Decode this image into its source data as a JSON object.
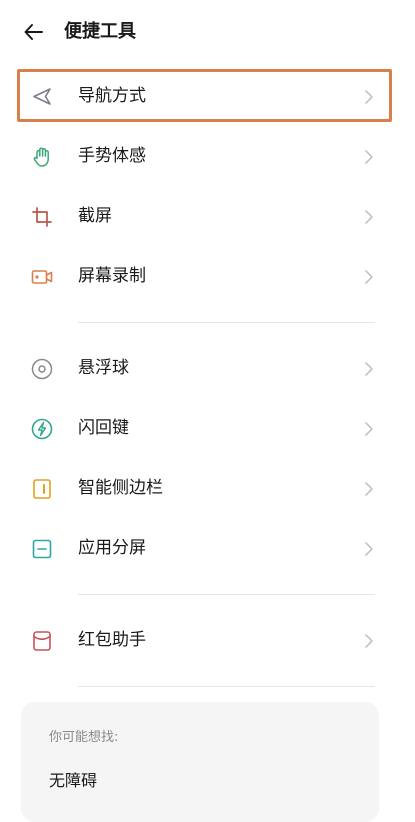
{
  "header": {
    "title": "便捷工具",
    "back_icon": "arrow-left-icon"
  },
  "sections": [
    {
      "items": [
        {
          "label": "导航方式",
          "icon": "navigation-arrow-icon",
          "icon_color": "#7d7d8a",
          "highlighted": true
        },
        {
          "label": "手势体感",
          "icon": "hand-gesture-icon",
          "icon_color": "#3aa876"
        },
        {
          "label": "截屏",
          "icon": "crop-icon",
          "icon_color": "#b8584a"
        },
        {
          "label": "屏幕录制",
          "icon": "video-record-icon",
          "icon_color": "#d9804a"
        }
      ]
    },
    {
      "items": [
        {
          "label": "悬浮球",
          "icon": "floating-ball-icon",
          "icon_color": "#8a8a8a"
        },
        {
          "label": "闪回键",
          "icon": "flash-back-icon",
          "icon_color": "#2ea88f"
        },
        {
          "label": "智能侧边栏",
          "icon": "smart-sidebar-icon",
          "icon_color": "#e0a020"
        },
        {
          "label": "应用分屏",
          "icon": "split-screen-icon",
          "icon_color": "#2ea8a0"
        }
      ]
    },
    {
      "items": [
        {
          "label": "红包助手",
          "icon": "red-envelope-icon",
          "icon_color": "#c8505a"
        }
      ]
    }
  ],
  "suggestions": {
    "heading": "你可能想找:",
    "items": [
      "无障碍"
    ]
  },
  "colors": {
    "highlight_border": "#d9804a",
    "chevron": "#c4c4c4",
    "divider": "#e6e6e6",
    "card_background": "#f5f5f5"
  }
}
